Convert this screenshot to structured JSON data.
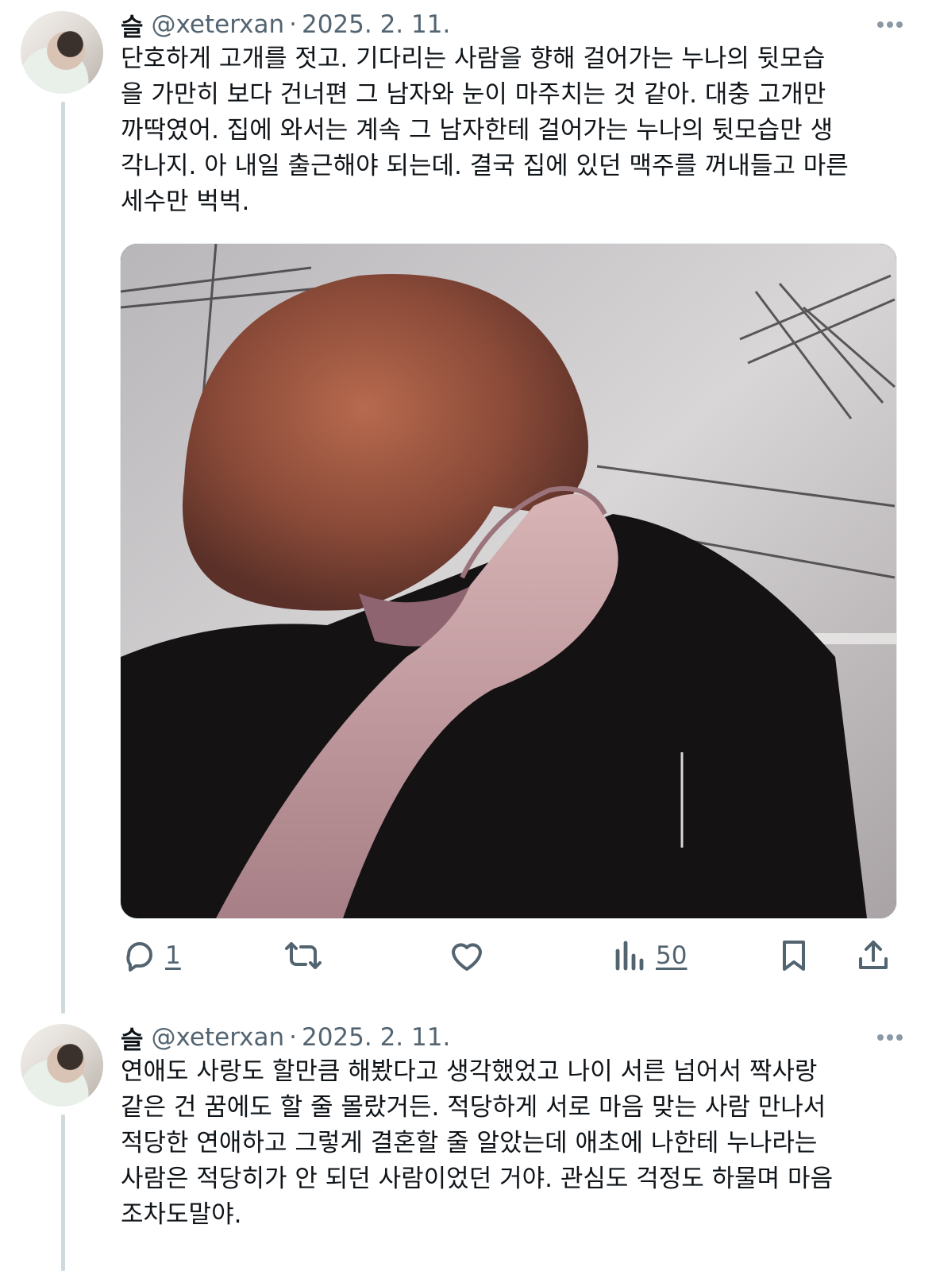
{
  "tweets": [
    {
      "display_name": "슬",
      "handle": "@xeterxan",
      "separator": "·",
      "date": "2025. 2. 11.",
      "text": "단호하게 고개를 젓고. 기다리는 사람을 향해 걸어가는 누나의 뒷모습\n을 가만히 보다 건너편 그 남자와 눈이 마주치는 것 같아. 대충 고개만\n까딱였어. 집에 와서는 계속 그 남자한테 걸어가는 누나의 뒷모습만 생\n각나지. 아 내일 출근해야 되는데. 결국 집에 있던 맥주를 꺼내들고 마른\n세수만 벅벅.",
      "media": {
        "kind": "photo"
      },
      "actions": {
        "reply_count": "1",
        "retweet_count": "",
        "like_count": "",
        "views_count": "50"
      }
    },
    {
      "display_name": "슬",
      "handle": "@xeterxan",
      "separator": "·",
      "date": "2025. 2. 11.",
      "text": "연애도 사랑도 할만큼 해봤다고 생각했었고 나이 서른 넘어서 짝사랑\n같은 건 꿈에도 할 줄 몰랐거든. 적당하게 서로 마음 맞는 사람 만나서\n적당한 연애하고 그렇게 결혼할 줄 알았는데 애초에 나한테 누나라는\n사람은 적당히가 안 되던 사람이었던 거야. 관심도 걱정도 하물며 마음\n조차도말야."
    }
  ],
  "icons": {
    "reply": "reply-icon",
    "retweet": "retweet-icon",
    "like": "heart-icon",
    "views": "views-chart-icon",
    "bookmark": "bookmark-icon",
    "share": "share-icon",
    "more": "more-dots-icon"
  },
  "colors": {
    "text": "#0f1419",
    "secondary": "#536471",
    "thread_line": "#cfd9de"
  }
}
